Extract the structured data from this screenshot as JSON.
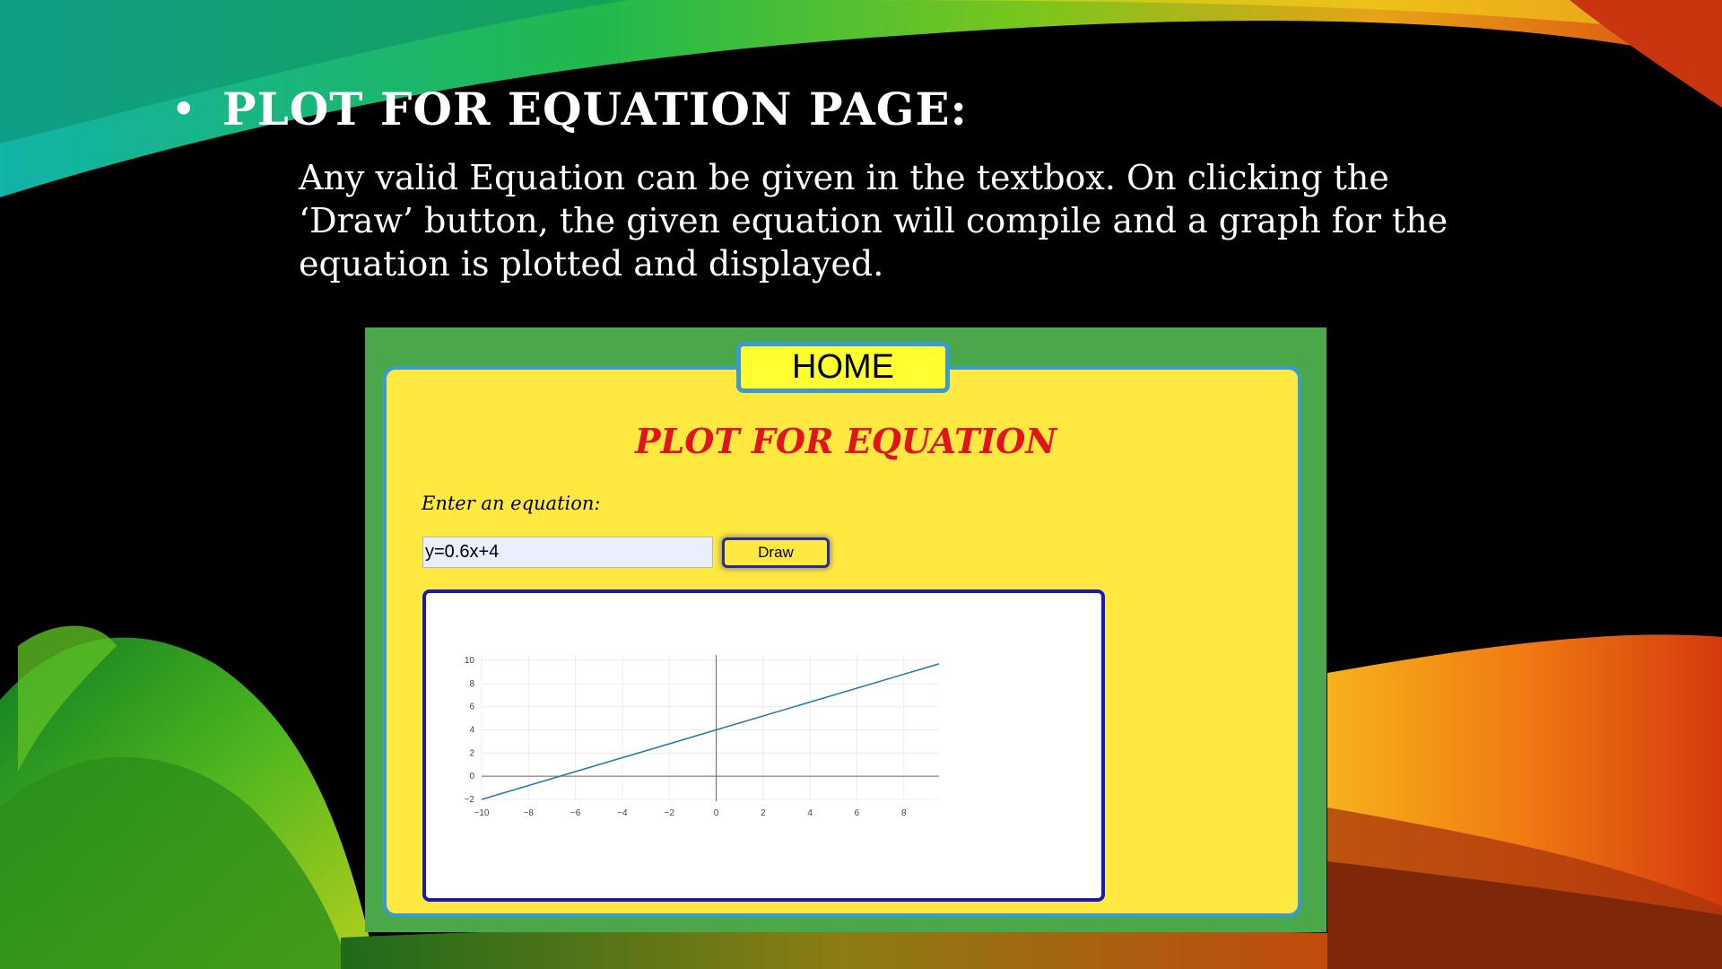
{
  "slide": {
    "bullet": "•",
    "heading": "PLOT FOR EQUATION PAGE:",
    "body": "Any valid Equation can be given in the textbox. On clicking the ‘Draw’ button, the given equation will compile and a graph for the equation is plotted and displayed."
  },
  "app": {
    "home_label": "HOME",
    "title": "PLOT FOR EQUATION",
    "equation_label": "Enter an equation:",
    "equation_value": "y=0.6x+4",
    "draw_label": "Draw",
    "colors": {
      "frame": "#4aa84b",
      "panel": "#ffe840",
      "title": "#e0141c",
      "line": "#1f77b4"
    }
  },
  "chart_data": {
    "type": "line",
    "equation": "y=0.6x+4",
    "x": [
      -10,
      9.5
    ],
    "y": [
      -2,
      9.7
    ],
    "xlim": [
      -10,
      9.5
    ],
    "ylim": [
      -2,
      10
    ],
    "x_ticks": [
      "−10",
      "−8",
      "−6",
      "−4",
      "−2",
      "0",
      "2",
      "4",
      "6",
      "8"
    ],
    "y_ticks": [
      "10",
      "8",
      "6",
      "4",
      "2",
      "0",
      "−2"
    ],
    "grid": true
  }
}
